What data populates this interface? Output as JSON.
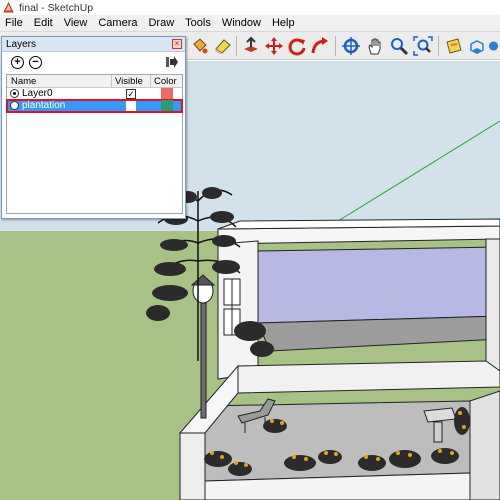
{
  "window": {
    "title": "final - SketchUp",
    "app_icon": "sketchup-icon"
  },
  "menu": [
    "File",
    "Edit",
    "View",
    "Camera",
    "Draw",
    "Tools",
    "Window",
    "Help"
  ],
  "toolbar": {
    "tools": [
      {
        "name": "paint-bucket-icon",
        "color": "#c77a18"
      },
      {
        "name": "eraser-icon",
        "color": "#e5c23a"
      },
      {
        "name": "push-pull-icon",
        "color": "#c0392b"
      },
      {
        "name": "move-icon",
        "color": "#d0201a"
      },
      {
        "name": "rotate-icon",
        "color": "#d0201a"
      },
      {
        "name": "follow-me-icon",
        "color": "#d0201a"
      },
      {
        "name": "orbit-icon",
        "color": "#1f5fbf"
      },
      {
        "name": "pan-hand-icon",
        "color": "#333333"
      },
      {
        "name": "zoom-icon",
        "color": "#1f5fbf"
      },
      {
        "name": "zoom-extents-icon",
        "color": "#1f5fbf"
      },
      {
        "name": "section-plane-icon",
        "color": "#e5c23a"
      },
      {
        "name": "walk-icon",
        "color": "#2a7fd3"
      },
      {
        "name": "look-around-icon",
        "color": "#2a7fd3"
      }
    ]
  },
  "layers_panel": {
    "title": "Layers",
    "close_icon": "close-icon",
    "add_icon": "add-layer-icon",
    "delete_icon": "delete-layer-icon",
    "details_icon": "details-arrow-icon",
    "columns": {
      "name": "Name",
      "visible": "Visible",
      "color": "Color"
    },
    "layers": [
      {
        "name": "Layer0",
        "active": true,
        "visible": true,
        "color": "#f06a6a",
        "selected": false
      },
      {
        "name": "plantation",
        "active": false,
        "visible": false,
        "color": "#2f9a72",
        "selected": true
      }
    ]
  },
  "colors": {
    "sky": "#d3e1ea",
    "ground": "#a8c184",
    "building_white": "#f6f6f6",
    "building_floor": "#bdbdbd",
    "interior_wall": "#b7b9e4",
    "axis_green": "#2aa63a"
  }
}
